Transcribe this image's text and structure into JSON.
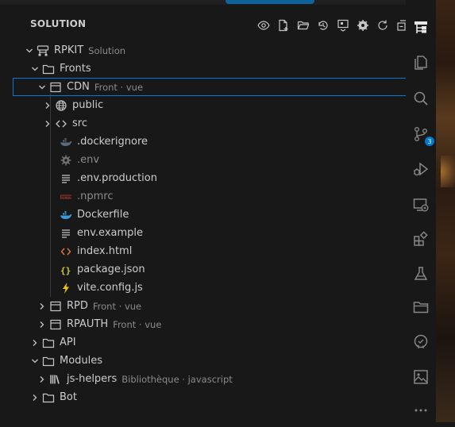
{
  "explorer": {
    "title": "SOLUTION"
  },
  "tree": {
    "solution": {
      "name": "RPKIT",
      "desc": "Solution"
    },
    "fronts": {
      "label": "Fronts"
    },
    "cdn": {
      "name": "CDN",
      "desc": "Front · vue"
    },
    "files": [
      {
        "label": "public"
      },
      {
        "label": "src"
      },
      {
        "label": ".dockerignore"
      },
      {
        "label": ".env"
      },
      {
        "label": ".env.production"
      },
      {
        "label": ".npmrc"
      },
      {
        "label": "Dockerfile"
      },
      {
        "label": "env.example"
      },
      {
        "label": "index.html"
      },
      {
        "label": "package.json"
      },
      {
        "label": "vite.config.js"
      }
    ],
    "rpd": {
      "name": "RPD",
      "desc": "Front · vue"
    },
    "rpauth": {
      "name": "RPAUTH",
      "desc": "Front · vue"
    },
    "api": {
      "label": "API"
    },
    "modules": {
      "label": "Modules"
    },
    "jshelpers": {
      "name": "js-helpers",
      "desc": "Bibliothèque · javascript"
    },
    "bot": {
      "label": "Bot"
    }
  },
  "activity_bar": {
    "source_control_badge": "3",
    "items": [
      "solution-explorer-icon",
      "files-icon",
      "search-icon",
      "source-control-icon",
      "run-debug-icon",
      "remote-explorer-icon",
      "extensions-icon",
      "testing-icon",
      "folder-icon",
      "github-icon",
      "image-preview-icon",
      "more-icon"
    ]
  },
  "colors": {
    "accent": "#0078d4",
    "panel_bg": "#181818",
    "text": "#cccccc",
    "description": "#8b8b8b"
  }
}
